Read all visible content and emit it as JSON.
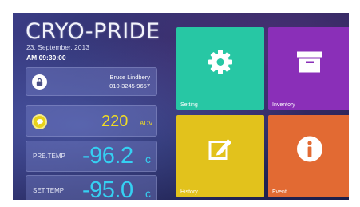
{
  "header": {
    "brand": "CRYO-PRIDE",
    "date": "23, September, 2013",
    "time": "AM 09:30:00"
  },
  "user": {
    "icon": "lock-icon",
    "name": "Bruce Lindbery",
    "phone": "010-3245-9657"
  },
  "level": {
    "icon": "chat-bubble-icon",
    "value": "220",
    "unit": "ADV"
  },
  "pre_temp": {
    "label": "PRE.TEMP",
    "value": "-96.2",
    "unit": "c"
  },
  "set_temp": {
    "label": "SET.TEMP",
    "value": "-95.0",
    "unit": "c"
  },
  "tiles": [
    {
      "label": "Setting",
      "icon": "gear-icon",
      "color": "#27c7a4"
    },
    {
      "label": "Inventory",
      "icon": "archive-box-icon",
      "color": "#8a2fb8"
    },
    {
      "label": "History",
      "icon": "edit-icon",
      "color": "#e2c21c"
    },
    {
      "label": "Event",
      "icon": "info-icon",
      "color": "#e26a33"
    }
  ],
  "colors": {
    "temp_text": "#35d0f2",
    "level_text": "#f0dc24"
  }
}
